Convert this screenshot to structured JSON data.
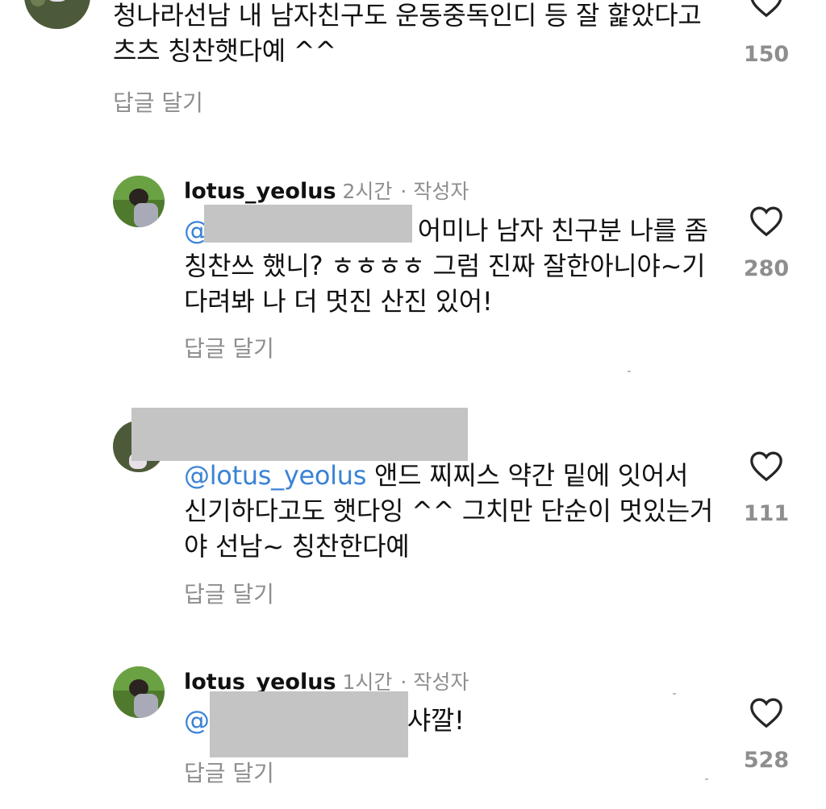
{
  "comments": [
    {
      "text": "청나라선남 내 남자친구도 운동중독인디 등 잘 핥았다고 츠츠 칭찬햇다예 ^^",
      "reply_label": "답글 달기",
      "likes": "150"
    },
    {
      "username": "lotus_yeolus",
      "time": "2시간",
      "author_label": "· 작성자",
      "mention_prefix": "@",
      "text": "어미나 남자 친구분 나를 좀 칭찬쓰 했니? ㅎㅎㅎㅎ 그럼 진짜 잘한아니야~기다려봐 나 더 멋진 산진 있어!",
      "reply_label": "답글 달기",
      "likes": "280"
    },
    {
      "mention": "@lotus_yeolus",
      "text": "앤드 찌찌스 약간 밑에 잇어서 신기하다고도 햇다잉 ^^ 그치만 단순이 멋있는거야 선남~ 칭찬한다예",
      "reply_label": "답글 달기",
      "likes": "111"
    },
    {
      "username": "lotus_yeolus",
      "time": "1시간",
      "author_label": "· 작성자",
      "mention_prefix": "@",
      "text": "샤깔!",
      "reply_label": "답글 달기",
      "likes": "528"
    }
  ],
  "icons": {
    "like": "heart-outline-icon"
  },
  "colors": {
    "mention": "#3a83d6",
    "muted": "#8e8e8e",
    "redaction": "#c4c4c4"
  }
}
